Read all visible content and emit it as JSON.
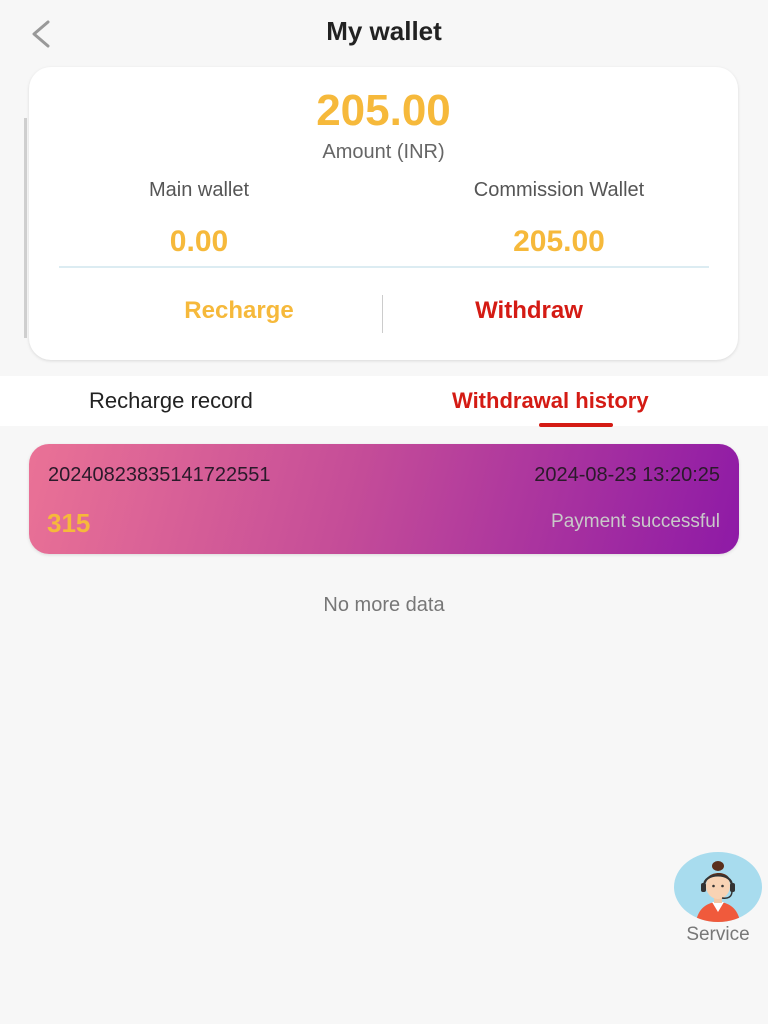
{
  "header": {
    "title": "My wallet",
    "back_icon": "chevron-left-icon"
  },
  "balance": {
    "total_amount": "205.00",
    "total_label": "Amount (INR)",
    "main_wallet_label": "Main wallet",
    "main_wallet_value": "0.00",
    "commission_wallet_label": "Commission Wallet",
    "commission_wallet_value": "205.00",
    "recharge_label": "Recharge",
    "withdraw_label": "Withdraw"
  },
  "tabs": [
    {
      "label": "Recharge record",
      "active": false
    },
    {
      "label": "Withdrawal history",
      "active": true
    }
  ],
  "records": [
    {
      "id": "20240823835141722551",
      "time": "2024-08-23 13:20:25",
      "amount": "315",
      "status": "Payment successful"
    }
  ],
  "no_more_text": "No more data",
  "service": {
    "label": "Service",
    "icon": "customer-service-agent-icon"
  },
  "colors": {
    "accent_gold": "#f6b93b",
    "accent_red": "#d41b14",
    "record_gradient_start": "#ea7296",
    "record_gradient_end": "#8e1aa6",
    "background": "#f7f7f7"
  }
}
